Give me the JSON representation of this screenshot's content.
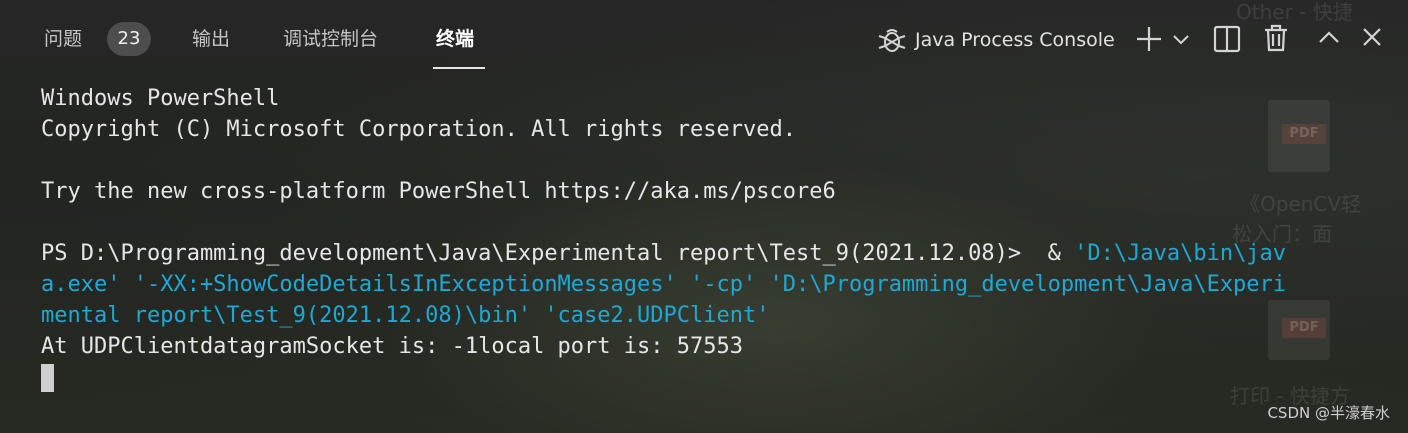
{
  "tabs": [
    {
      "label": "问题",
      "active": false
    },
    {
      "label": "输出",
      "active": false
    },
    {
      "label": "调试控制台",
      "active": false
    },
    {
      "label": "终端",
      "active": true
    }
  ],
  "problems_count": "23",
  "toolbar": {
    "console_name": "Java Process Console",
    "icons": [
      "java-debug-icon",
      "plus-icon",
      "chevron-down-icon",
      "split-terminal-icon",
      "trash-icon",
      "chevron-up-icon",
      "close-icon"
    ]
  },
  "terminal": {
    "lines": [
      {
        "text": "Windows PowerShell",
        "command": ""
      },
      {
        "text": "Copyright (C) Microsoft Corporation. All rights reserved.",
        "command": ""
      },
      {
        "text": "",
        "command": ""
      },
      {
        "text": "Try the new cross-platform PowerShell https://aka.ms/pscore6",
        "command": ""
      },
      {
        "text": "",
        "command": ""
      },
      {
        "text": "PS D:\\Programming_development\\Java\\Experimental report\\Test_9(2021.12.08)>  & ",
        "command": "'D:\\Java\\bin\\jav"
      },
      {
        "text": "",
        "command": "a.exe' '-XX:+ShowCodeDetailsInExceptionMessages' '-cp' 'D:\\Programming_development\\Java\\Experi"
      },
      {
        "text": "",
        "command": "mental report\\Test_9(2021.12.08)\\bin' 'case2.UDPClient'"
      },
      {
        "text": "At UDPClientdatagramSocket is: -1local port is: 57553",
        "command": ""
      }
    ]
  },
  "colors": {
    "background": "#1e1e1e",
    "text": "#e6e6e6",
    "command": "#1ea8d6"
  },
  "watermark": "CSDN @半濠春水"
}
